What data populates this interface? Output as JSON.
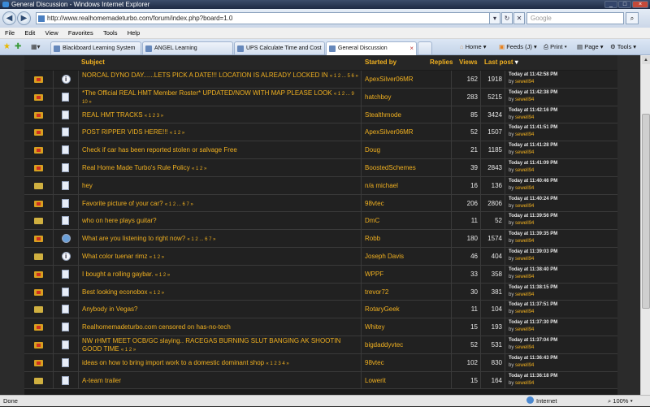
{
  "window": {
    "title": "General Discussion - Windows Internet Explorer"
  },
  "address": {
    "url": "http://www.realhomemadeturbo.com/forum/index.php?board=1.0",
    "search_placeholder": "Google"
  },
  "menu": [
    "File",
    "Edit",
    "View",
    "Favorites",
    "Tools",
    "Help"
  ],
  "tabs": [
    {
      "label": "Blackboard Learning System"
    },
    {
      "label": "ANGEL Learning"
    },
    {
      "label": "UPS Calculate Time and Cost"
    },
    {
      "label": "General Discussion"
    }
  ],
  "commandbar": {
    "home": "Home",
    "feeds": "Feeds (J)",
    "print": "Print",
    "page": "Page",
    "tools": "Tools"
  },
  "table": {
    "headers": {
      "subject": "Subject",
      "started_by": "Started by",
      "replies": "Replies",
      "views": "Views",
      "last_post": "Last post"
    },
    "rows": [
      {
        "icon": "hot-folder",
        "ticon": "info",
        "subject": "NORCAL DYNO DAY......LETS PICK A DATE!!! LOCATION IS ALREADY LOCKED IN",
        "pages": "« 1 2 ... 5 6 »",
        "starter": "ApexSilver06MR",
        "replies": "162",
        "views": "1918",
        "last_date": "Today at 11:42:58 PM",
        "by": "by ",
        "last_by": "sewell94"
      },
      {
        "icon": "hot-folder",
        "ticon": "doc",
        "subject": "*The Official REAL HMT Member Roster* UPDATED/NOW WITH MAP PLEASE LOOK",
        "pages": "« 1 2 ... 9 10 »",
        "starter": "hatchboy",
        "replies": "283",
        "views": "5215",
        "last_date": "Today at 11:42:38 PM",
        "by": "by ",
        "last_by": "sewell94"
      },
      {
        "icon": "hot-folder",
        "ticon": "doc",
        "subject": "REAL HMT TRACKS",
        "pages": "« 1 2 3 »",
        "starter": "Stealthmode",
        "replies": "85",
        "views": "3424",
        "last_date": "Today at 11:42:16 PM",
        "by": "by ",
        "last_by": "sewell94"
      },
      {
        "icon": "hot-folder",
        "ticon": "doc",
        "subject": "POST RIPPER VIDS HERE!!!",
        "pages": "« 1 2 »",
        "starter": "ApexSilver06MR",
        "replies": "52",
        "views": "1507",
        "last_date": "Today at 11:41:51 PM",
        "by": "by ",
        "last_by": "sewell94"
      },
      {
        "icon": "hot-folder",
        "ticon": "doc",
        "subject": "Check if car has been reported stolen or salvage Free",
        "pages": "",
        "starter": "Doug",
        "replies": "21",
        "views": "1185",
        "last_date": "Today at 11:41:28 PM",
        "by": "by ",
        "last_by": "sewell94"
      },
      {
        "icon": "hot-folder",
        "ticon": "doc",
        "subject": "Real Home Made Turbo's Rule Policy",
        "pages": "« 1 2 »",
        "starter": "BoostedSchemes",
        "replies": "39",
        "views": "2843",
        "last_date": "Today at 11:41:09 PM",
        "by": "by ",
        "last_by": "sewell94"
      },
      {
        "icon": "folder",
        "ticon": "doc",
        "subject": "hey",
        "pages": "",
        "starter": "n/a michael",
        "replies": "16",
        "views": "136",
        "last_date": "Today at 11:40:46 PM",
        "by": "by ",
        "last_by": "sewell94"
      },
      {
        "icon": "hot-folder",
        "ticon": "doc",
        "subject": "Favorite picture of your car?",
        "pages": "« 1 2 ... 6 7 »",
        "starter": "98vtec",
        "replies": "206",
        "views": "2806",
        "last_date": "Today at 11:40:24 PM",
        "by": "by ",
        "last_by": "sewell94"
      },
      {
        "icon": "folder",
        "ticon": "doc",
        "subject": "who on here plays guitar?",
        "pages": "",
        "starter": "DmC",
        "replies": "11",
        "views": "52",
        "last_date": "Today at 11:39:56 PM",
        "by": "by ",
        "last_by": "sewell94"
      },
      {
        "icon": "hot-folder",
        "ticon": "poll",
        "subject": "What are you listening to right now?",
        "pages": "« 1 2 ... 6 7 »",
        "starter": "Robb",
        "replies": "180",
        "views": "1574",
        "last_date": "Today at 11:39:35 PM",
        "by": "by ",
        "last_by": "sewell94"
      },
      {
        "icon": "folder",
        "ticon": "info",
        "subject": "What color tuenar rimz",
        "pages": "« 1 2 »",
        "starter": "Joseph Davis",
        "replies": "46",
        "views": "404",
        "last_date": "Today at 11:39:03 PM",
        "by": "by ",
        "last_by": "sewell94"
      },
      {
        "icon": "hot-folder",
        "ticon": "doc",
        "subject": "I bought a rolling gaybar.",
        "pages": "« 1 2 »",
        "starter": "WPPF",
        "replies": "33",
        "views": "358",
        "last_date": "Today at 11:38:40 PM",
        "by": "by ",
        "last_by": "sewell94"
      },
      {
        "icon": "hot-folder",
        "ticon": "doc",
        "subject": "Best looking econobox",
        "pages": "« 1 2 »",
        "starter": "trevor72",
        "replies": "30",
        "views": "381",
        "last_date": "Today at 11:38:15 PM",
        "by": "by ",
        "last_by": "sewell94"
      },
      {
        "icon": "folder",
        "ticon": "doc",
        "subject": "Anybody in Vegas?",
        "pages": "",
        "starter": "RotaryGeek",
        "replies": "11",
        "views": "104",
        "last_date": "Today at 11:37:51 PM",
        "by": "by ",
        "last_by": "sewell94"
      },
      {
        "icon": "hot-folder",
        "ticon": "doc",
        "subject": "Realhomemadeturbo.com censored on has-no-tech",
        "pages": "",
        "starter": "Whitey",
        "replies": "15",
        "views": "193",
        "last_date": "Today at 11:37:30 PM",
        "by": "by ",
        "last_by": "sewell94"
      },
      {
        "icon": "hot-folder",
        "ticon": "doc",
        "subject": "NW rHMT MEET OCB/GC slaying.. RACEGAS BURNING SLUT BANGING AK SHOOTIN GOOD TIME",
        "pages": "« 1 2 »",
        "starter": "bigdaddyvtec",
        "replies": "52",
        "views": "531",
        "last_date": "Today at 11:37:04 PM",
        "by": "by ",
        "last_by": "sewell94"
      },
      {
        "icon": "hot-folder",
        "ticon": "doc",
        "subject": "ideas on how to bring import work to a domestic dominant shop",
        "pages": "« 1 2 3 4 »",
        "starter": "98vtec",
        "replies": "102",
        "views": "830",
        "last_date": "Today at 11:36:43 PM",
        "by": "by ",
        "last_by": "sewell94"
      },
      {
        "icon": "folder",
        "ticon": "doc",
        "subject": "A-team trailer",
        "pages": "",
        "starter": "Lowerit",
        "replies": "15",
        "views": "164",
        "last_date": "Today at 11:36:18 PM",
        "by": "by ",
        "last_by": "sewell94"
      }
    ]
  },
  "status": {
    "left": "Done",
    "zone": "Internet",
    "zoom": "100%"
  }
}
